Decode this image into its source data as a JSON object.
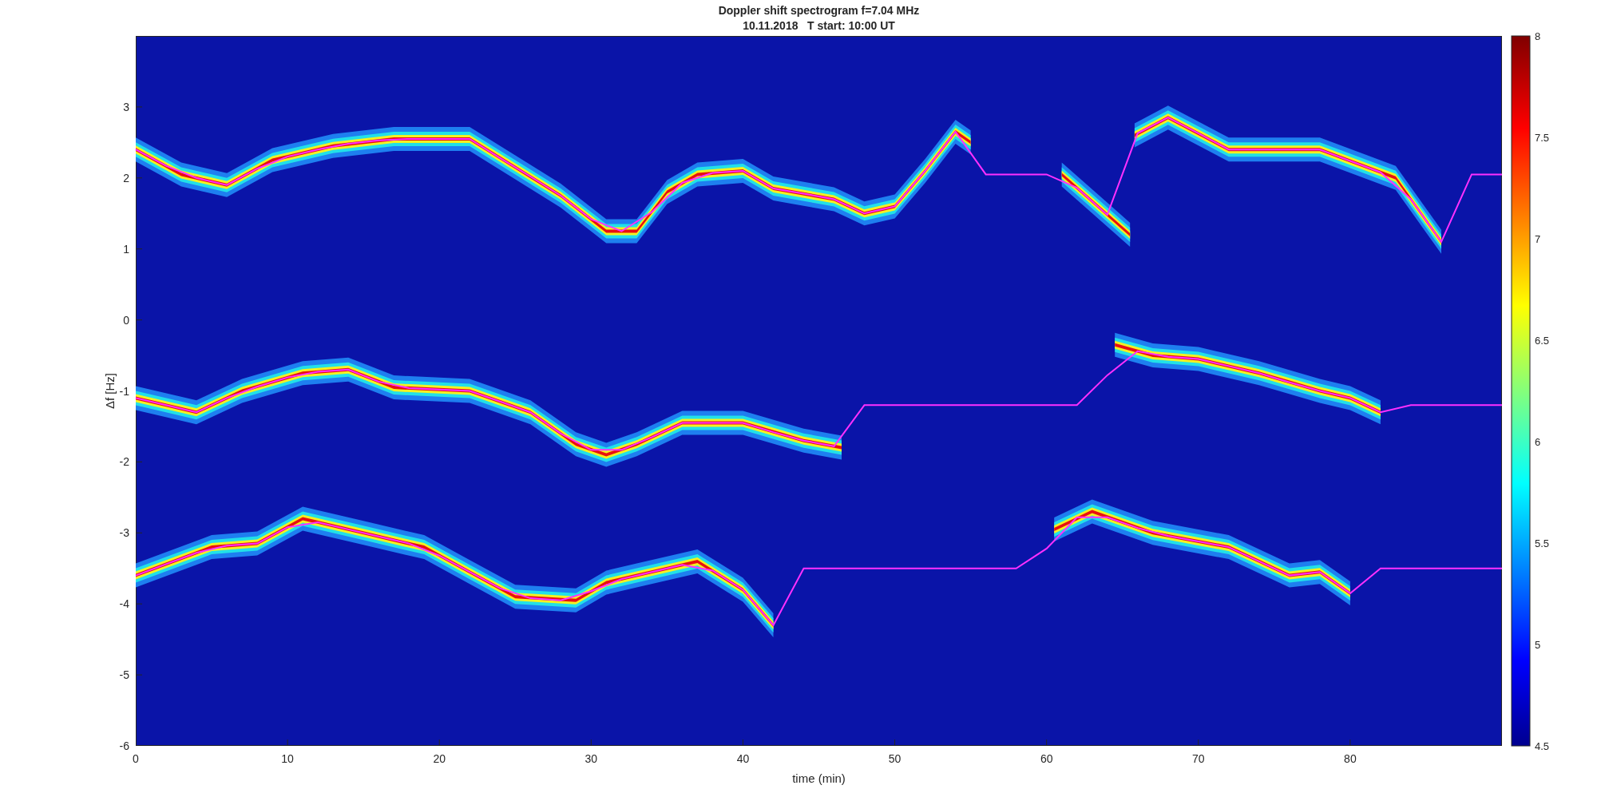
{
  "title": "Doppler shift spectrogram f=7.04 MHz",
  "subtitle": "10.11.2018   T start: 10:00 UT",
  "chart_data": {
    "type": "line",
    "xlabel": "time (min)",
    "ylabel": "Δf [Hz]",
    "xlim": [
      0,
      90
    ],
    "ylim": [
      -6,
      4
    ],
    "xticks": [
      0,
      10,
      20,
      30,
      40,
      50,
      60,
      70,
      80
    ],
    "yticks": [
      3,
      2,
      1,
      0,
      -1,
      -2,
      -3,
      -4,
      -5,
      -6
    ],
    "x": [
      0,
      2,
      4,
      6,
      8,
      10,
      12,
      14,
      16,
      18,
      20,
      22,
      24,
      26,
      28,
      30,
      32,
      34,
      36,
      38,
      40,
      42,
      44,
      46,
      48,
      50,
      52,
      54,
      56,
      58,
      60,
      62,
      64,
      66,
      68,
      70,
      72,
      74,
      76,
      78,
      80,
      82,
      84,
      86,
      88,
      90
    ],
    "series": [
      {
        "color": "#ff30ff",
        "values": [
          2.4,
          2.17,
          2.0,
          1.9,
          2.13,
          2.3,
          2.4,
          2.48,
          2.53,
          2.55,
          2.55,
          2.55,
          2.28,
          2.02,
          1.75,
          1.42,
          1.25,
          1.52,
          1.93,
          2.07,
          2.1,
          1.85,
          1.78,
          1.7,
          1.5,
          1.6,
          2.1,
          2.65,
          2.05,
          2.05,
          2.05,
          1.86,
          1.48,
          2.63,
          2.85,
          2.63,
          2.4,
          2.4,
          2.4,
          2.4,
          2.24,
          2.08,
          1.7,
          1.1,
          2.05,
          2.05
        ]
      },
      {
        "color": "#ff30ff",
        "values": [
          -1.1,
          -1.2,
          -1.3,
          -1.1,
          -0.94,
          -0.81,
          -0.73,
          -0.7,
          -0.87,
          -0.96,
          -0.98,
          -1.0,
          -1.15,
          -1.3,
          -1.6,
          -1.83,
          -1.83,
          -1.65,
          -1.45,
          -1.45,
          -1.45,
          -1.58,
          -1.7,
          -1.78,
          -1.2,
          -1.2,
          -1.2,
          -1.2,
          -1.2,
          -1.2,
          -1.2,
          -1.2,
          -0.78,
          -0.44,
          -0.52,
          -0.55,
          -0.65,
          -0.75,
          -0.88,
          -1.0,
          -1.1,
          -1.3,
          -1.2,
          -1.2,
          -1.2,
          -1.2
        ]
      },
      {
        "color": "#ff30ff",
        "values": [
          -3.6,
          -3.44,
          -3.28,
          -3.18,
          -3.15,
          -2.92,
          -2.85,
          -2.95,
          -3.05,
          -3.15,
          -3.32,
          -3.55,
          -3.78,
          -3.92,
          -3.95,
          -3.82,
          -3.65,
          -3.55,
          -3.45,
          -3.53,
          -3.8,
          -4.3,
          -3.5,
          -3.5,
          -3.5,
          -3.5,
          -3.5,
          -3.5,
          -3.5,
          -3.5,
          -3.22,
          -2.78,
          -2.78,
          -2.93,
          -3.04,
          -3.12,
          -3.2,
          -3.4,
          -3.6,
          -3.55,
          -3.85,
          -3.5,
          -3.5,
          -3.5,
          -3.5,
          -3.5
        ]
      }
    ]
  },
  "colorbar_ticks": [
    "8",
    "7.5",
    "7",
    "6.5",
    "6",
    "5.5",
    "5",
    "4.5"
  ]
}
